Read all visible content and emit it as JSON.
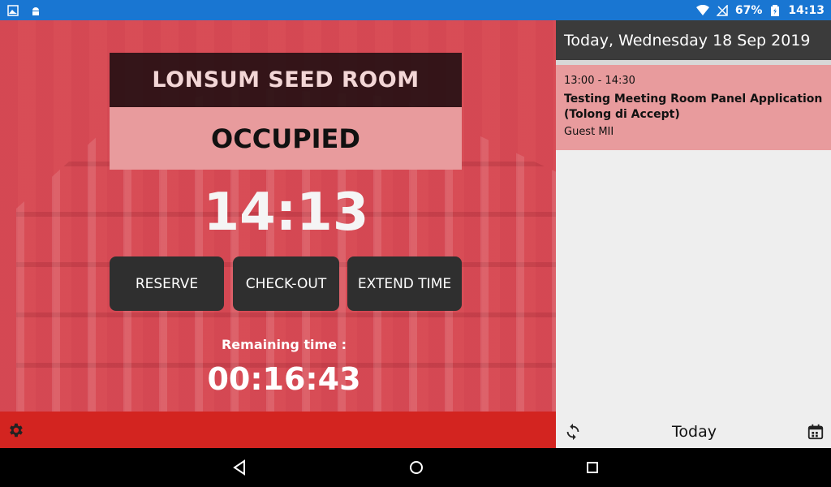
{
  "statusbar": {
    "left_icons": [
      "gallery-icon",
      "android-icon"
    ],
    "battery_percent": "67%",
    "time": "14:13"
  },
  "room": {
    "name": "LONSUM SEED ROOM",
    "status": "OCCUPIED",
    "clock": "14:13"
  },
  "buttons": {
    "reserve": "RESERVE",
    "checkout": "CHECK-OUT",
    "extend": "EXTEND TIME"
  },
  "remaining": {
    "label": "Remaining time :",
    "value": "00:16:43"
  },
  "schedule": {
    "header": "Today, Wednesday 18 Sep 2019",
    "events": [
      {
        "time": "13:00 - 14:30",
        "title": "Testing Meeting Room Panel Application (Tolong di Accept)",
        "organizer": "Guest MII"
      }
    ],
    "footer_label": "Today"
  },
  "colors": {
    "statusbar": "#1976d2",
    "occupied_bg": "#e89b9d",
    "bottom_strip": "#d32420",
    "button_bg": "#2f2f2f"
  }
}
